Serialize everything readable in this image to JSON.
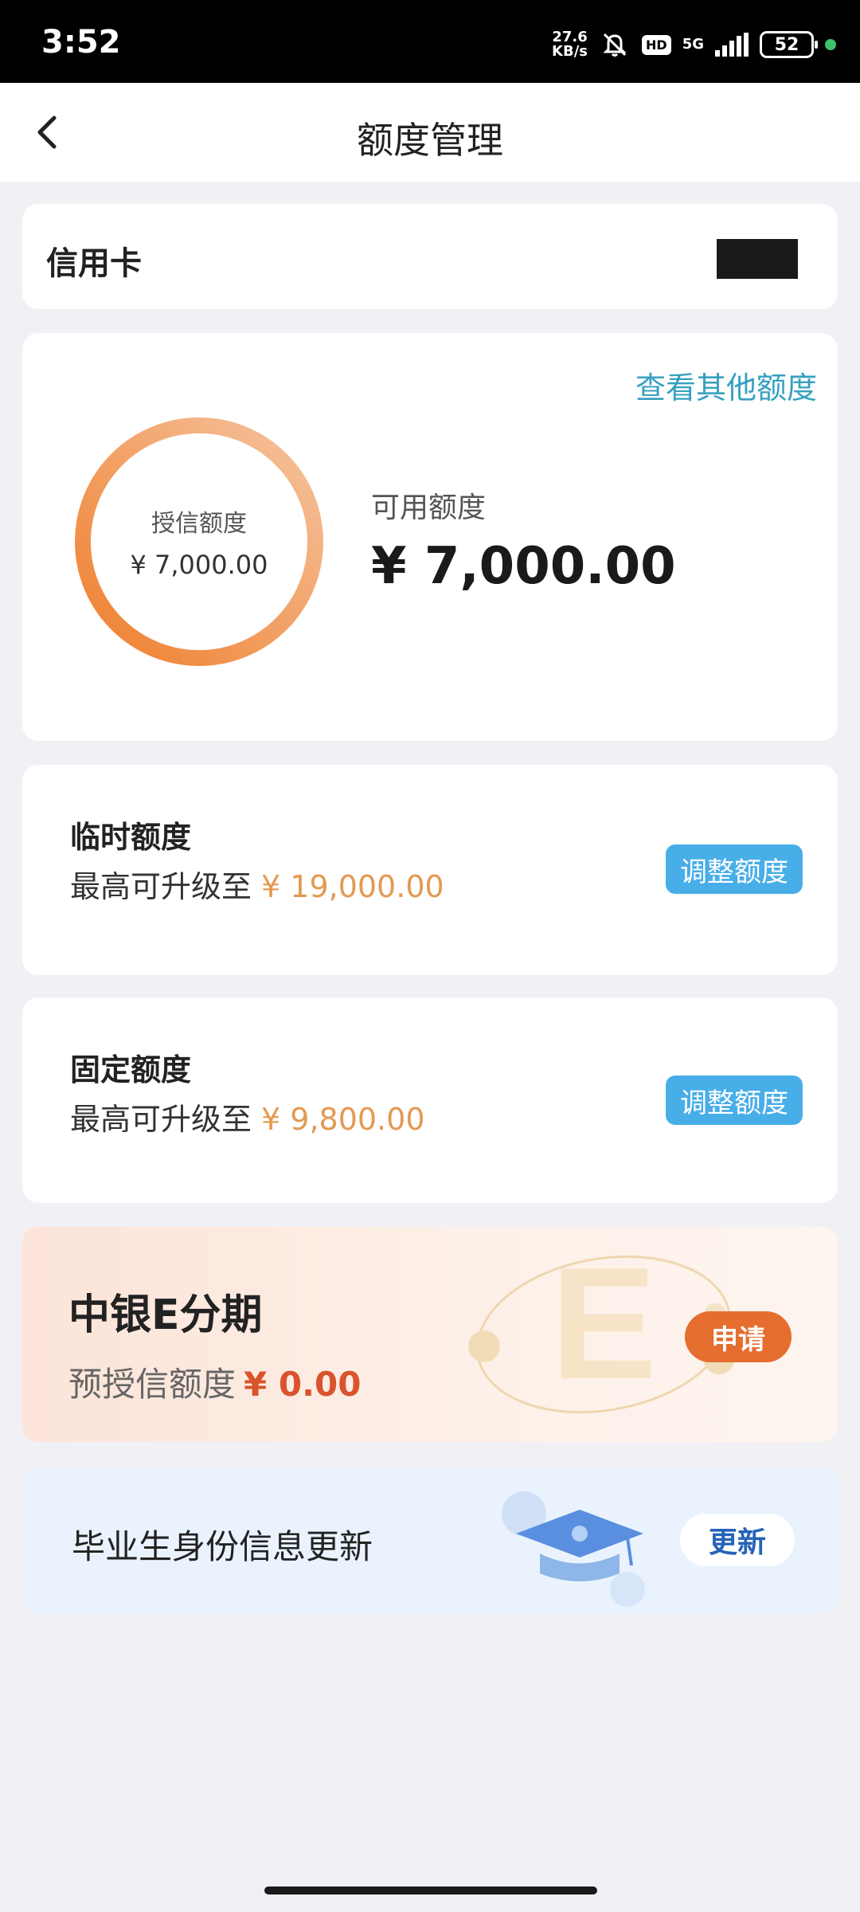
{
  "status_bar": {
    "time": "3:52",
    "net_speed_value": "27.6",
    "net_speed_unit": "KB/s",
    "hd_label": "HD",
    "network_label": "5G",
    "battery_level": "52",
    "icons": [
      "mute-icon",
      "signal-icon",
      "battery-icon"
    ]
  },
  "nav": {
    "title": "额度管理",
    "back_icon": "chevron-left-icon"
  },
  "card_type": {
    "label": "信用卡"
  },
  "limit_summary": {
    "other_limits_link": "查看其他额度",
    "credit_limit_label": "授信额度",
    "credit_limit_amount": "¥ 7,000.00",
    "available_label": "可用额度",
    "available_amount": "¥ 7,000.00",
    "ring_color_start": "#f08a3c",
    "ring_color_end": "#f5b98c"
  },
  "temp_limit": {
    "title": "临时额度",
    "desc_prefix": "最高可升级至",
    "amount": "¥ 19,000.00",
    "button": "调整额度"
  },
  "fixed_limit": {
    "title": "固定额度",
    "desc_prefix": "最高可升级至",
    "amount": "¥ 9,800.00",
    "button": "调整额度"
  },
  "e_installment": {
    "title": "中银E分期",
    "desc_prefix": "预授信额度",
    "amount": "¥ 0.00",
    "button": "申请"
  },
  "graduate": {
    "label": "毕业生身份信息更新",
    "button": "更新",
    "icon": "graduation-cap-icon"
  },
  "colors": {
    "accent_orange": "#e39a52",
    "link_teal": "#37a0c0",
    "button_blue": "#48aee8",
    "apply_orange": "#e56d2e"
  }
}
